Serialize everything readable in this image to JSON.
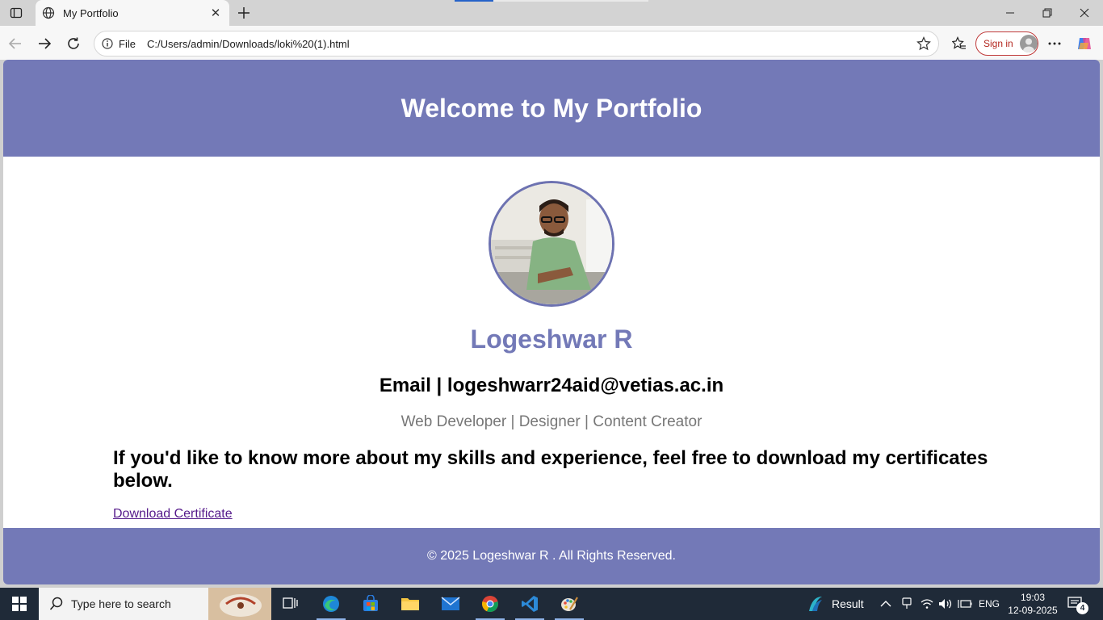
{
  "browser": {
    "tab_title": "My Portfolio",
    "tab_close": "✕",
    "address_scheme": "File",
    "address_url": "C:/Users/admin/Downloads/loki%20(1).html",
    "signin_label": "Sign in"
  },
  "page": {
    "header_title": "Welcome to My Portfolio",
    "name": "Logeshwar R",
    "email_line": "Email | logeshwarr24aid@vetias.ac.in",
    "roles": "Web Developer | Designer | Content Creator",
    "intro": "If you'd like to know more about my skills and experience, feel free to download my certificates below.",
    "download_link": "Download Certificate",
    "footer": "© 2025 Logeshwar R . All Rights Reserved."
  },
  "taskbar": {
    "search_placeholder": "Type here to search",
    "weather_label": "Result",
    "language": "ENG",
    "time": "19:03",
    "date": "12-09-2025",
    "notification_count": "4"
  },
  "colors": {
    "header_bg": "#7379b7",
    "name_color": "#7379b7",
    "link_color": "#551a8b",
    "taskbar_bg": "#1f2a38"
  }
}
